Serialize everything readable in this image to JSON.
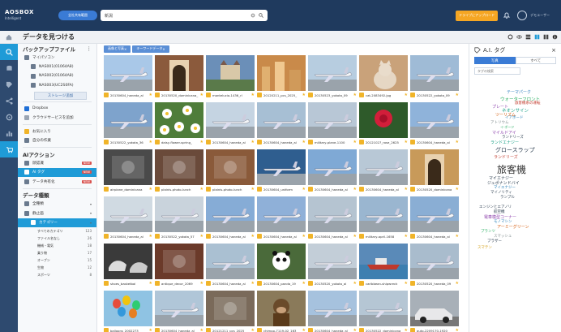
{
  "app": {
    "logo_line1": "AOSBOX",
    "logo_line2": "Intelligent",
    "scope_label": "全社共有範囲",
    "search_value": "新潟",
    "upload_label": "ドライブにアップロード",
    "user_name": "デモユーザー"
  },
  "subbar": {
    "page_title": "データを見つける"
  },
  "rail": {
    "icons": [
      "search-icon",
      "database-icon",
      "tag-icon",
      "share-icon",
      "gear-icon",
      "chart-icon",
      "cart-icon"
    ]
  },
  "sidebar": {
    "backup_title": "バックアップファイル",
    "backup_items": [
      "マイパソコン",
      "NAS001(01064A8)",
      "NAS002(01064A8)",
      "NAS003(UC2S0FA)"
    ],
    "add_button": "ストレージ追加",
    "cloud_items": [
      {
        "label": "Dropbox",
        "badge": ""
      },
      {
        "label": "クラウドサービスを追加",
        "badge": ""
      }
    ],
    "fav_items": [
      "お気に入り",
      "自分の作業"
    ],
    "ai_title": "AIアクション",
    "ai_items": [
      {
        "label": "顔認識",
        "badge": "NEW"
      },
      {
        "label": "AI タグ",
        "badge": "NEW"
      },
      {
        "label": "データ共有化",
        "badge": "NEW"
      }
    ],
    "type_title": "データ種類",
    "type_items": [
      "全種類",
      "静止画",
      "カテゴリー"
    ],
    "sub_items": [
      {
        "label": "すべてのカテゴリ",
        "count": "123"
      },
      {
        "label": "ファイル名なし",
        "count": "26"
      },
      {
        "label": "機械・電気",
        "count": "18"
      },
      {
        "label": "乗り物",
        "count": "17"
      },
      {
        "label": "オープン",
        "count": "15"
      },
      {
        "label": "生物",
        "count": "12"
      },
      {
        "label": "スポーツ",
        "count": "8"
      }
    ]
  },
  "chips": [
    "画像と写真",
    "キーワードデータ"
  ],
  "grid": {
    "items": [
      {
        "caption": "20130604_haneda_al",
        "kind": "plane",
        "bg": "#a9c8e8"
      },
      {
        "caption": "20130520_dominicana_",
        "kind": "arch",
        "bg": "#8b5a3c"
      },
      {
        "caption": "montelucia-1436_rl",
        "kind": "castle",
        "bg": "#6b8fb8"
      },
      {
        "caption": "20120211_pcs_2025_",
        "kind": "city",
        "bg": "#c98a4a"
      },
      {
        "caption": "20130523_yokota_09",
        "kind": "plane",
        "bg": "#b7cde0"
      },
      {
        "caption": "cat-2083492.jpg",
        "kind": "cat",
        "bg": "#c9a27a"
      },
      {
        "caption": "20130522_yokota_09",
        "kind": "plane",
        "bg": "#9fbbd6"
      },
      {
        "caption": "20130522_yokota_36",
        "kind": "plane",
        "bg": "#7ea3cc"
      },
      {
        "caption": "daisy-flower-spring_",
        "kind": "flower",
        "bg": "#4f7d3a"
      },
      {
        "caption": "20130604_haneda_al",
        "kind": "plane",
        "bg": "#c5d4e2"
      },
      {
        "caption": "20130604_haneda_al",
        "kind": "plane",
        "bg": "#a7bfd4"
      },
      {
        "caption": "military-plane-1100",
        "kind": "plane",
        "bg": "#b8c7d6"
      },
      {
        "caption": "20121027_rose_2625",
        "kind": "rose",
        "bg": "#2e5a2a"
      },
      {
        "caption": "20130604_haneda_al",
        "kind": "plane",
        "bg": "#8fb3da"
      },
      {
        "caption": "airplane_dominicana",
        "kind": "dark",
        "bg": "#4a4a4a"
      },
      {
        "caption": "plainis-photo-lunch",
        "kind": "dark",
        "bg": "#6a4a3a"
      },
      {
        "caption": "plainis-photo-lunch",
        "kind": "dark",
        "bg": "#8a5a3a"
      },
      {
        "caption": "20130604_uniform",
        "kind": "plane",
        "bg": "#2f5e8f"
      },
      {
        "caption": "20130604_haneda_al",
        "kind": "plane",
        "bg": "#7fa9d5"
      },
      {
        "caption": "20130604_haneda_al",
        "kind": "plane",
        "bg": "#b8c8d6"
      },
      {
        "caption": "20130520_dominicana",
        "kind": "arch",
        "bg": "#c89a5a"
      },
      {
        "caption": "20130604_haneda_al",
        "kind": "plane",
        "bg": "#d0dae2"
      },
      {
        "caption": "20130522_yokota_57",
        "kind": "plane",
        "bg": "#c9d3dc"
      },
      {
        "caption": "20130604_haneda_al",
        "kind": "plane",
        "bg": "#86acd6"
      },
      {
        "caption": "20130604_haneda_al",
        "kind": "plane",
        "bg": "#8fb0d8"
      },
      {
        "caption": "20130604_haneda_al",
        "kind": "plane",
        "bg": "#b5c4d1"
      },
      {
        "caption": "military-april-1658",
        "kind": "plane",
        "bg": "#9ab6d0"
      },
      {
        "caption": "20130604_haneda_al",
        "kind": "plane",
        "bg": "#8aaed4"
      },
      {
        "caption": "shoes_basketbal",
        "kind": "shoes",
        "bg": "#3a3a3a"
      },
      {
        "caption": "antique_decor_2069",
        "kind": "dark",
        "bg": "#6b3a2a"
      },
      {
        "caption": "20130604_haneda_al",
        "kind": "plane",
        "bg": "#aac0d2"
      },
      {
        "caption": "20130604_panda_19",
        "kind": "panda",
        "bg": "#4a6a3a"
      },
      {
        "caption": "20130520_yokota_al",
        "kind": "plane",
        "bg": "#c3ced8"
      },
      {
        "caption": "caribbean-shipwreck",
        "kind": "ship",
        "bg": "#5a8ab8"
      },
      {
        "caption": "20130520_haneda_09",
        "kind": "plane",
        "bg": "#a9bccd"
      },
      {
        "caption": "balloons_2002273",
        "kind": "balloons",
        "bg": "#8fc3e3"
      },
      {
        "caption": "20130604_haneda_al",
        "kind": "plane",
        "bg": "#b0c6d8"
      },
      {
        "caption": "20121211_pcs_2025",
        "kind": "dark",
        "bg": "#7a6a5a"
      },
      {
        "caption": "chimpo-7119-02_163",
        "kind": "monkey",
        "bg": "#8a7a5a"
      },
      {
        "caption": "20130604_haneda_al",
        "kind": "plane",
        "bg": "#a6c2de"
      },
      {
        "caption": "20130522_dominicana",
        "kind": "plane",
        "bg": "#b5c6d4"
      },
      {
        "caption": "auto-2209170-1920",
        "kind": "car",
        "bg": "#a8b0b8"
      }
    ]
  },
  "panel": {
    "title": "A.I. タグ",
    "tabs": [
      "写真",
      "すべて"
    ],
    "filter_placeholder": "タグの検索",
    "tags": [
      "テーマパーク",
      "ウォーターフロント",
      "旅客機系の運転",
      "プレート",
      "ネオンサイン",
      "ツーリズム",
      "イアボード",
      "アトリウム",
      "イ-ボード",
      "マイルドアイ",
      "ランドリーズ",
      "ランドエナジー",
      "グロースラップ",
      "ランドリーズ",
      "旅客機",
      "マイエナジー",
      "ジュポナンドバイ",
      "マイエナジー",
      "マイノリティ",
      "ランプル",
      "エンジンとエアノリ",
      "航空機",
      "電車模型コーナー",
      "モノマシン",
      "アーミーグリーン",
      "プランツ",
      "スマッシュ",
      "ブラザー",
      "スマテン"
    ]
  },
  "colors": {
    "topbar": "#1f3a5e",
    "accent": "#1f9bd7",
    "upload": "#f5a623",
    "badge": "#d9534f"
  }
}
